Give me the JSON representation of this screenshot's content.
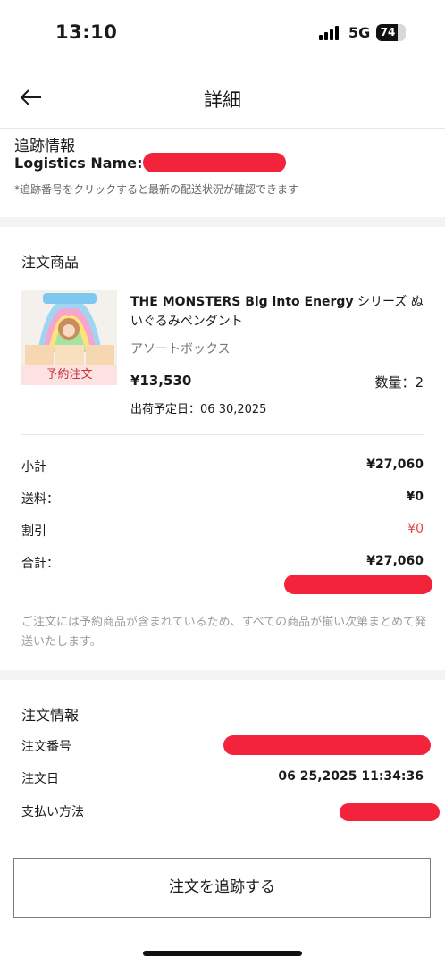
{
  "status_bar": {
    "time": "13:10",
    "network": "5G",
    "battery": "74",
    "battery_level": 0.74
  },
  "nav": {
    "title": "詳細"
  },
  "tracking": {
    "title": "追跡情報",
    "logistics_label": "Logistics Name:",
    "note": "*追跡番号をクリックすると最新の配送状況が確認できます"
  },
  "order_items": {
    "title": "注文商品",
    "product": {
      "name_en": "THE MONSTERS Big into Energy",
      "name_jp": " シリーズ ぬいぐるみペンダント",
      "variant": "アソートボックス",
      "price": "¥13,530",
      "quantity": "数量：2",
      "ship_date_label": "出荷予定日：",
      "ship_date": "06 30,2025",
      "tag": "予約注文"
    },
    "summary": [
      {
        "label": "小計",
        "value": "¥27,060"
      },
      {
        "label": "送料：",
        "value": "¥0"
      },
      {
        "label": "割引",
        "value": "¥0"
      },
      {
        "label": "合計：",
        "value": "¥27,060"
      }
    ],
    "notice": "ご注文には予約商品が含まれているため、すべての商品が揃い次第まとめて発送いたします。"
  },
  "order_info": {
    "title": "注文情報",
    "rows": [
      {
        "label": "注文番号",
        "value": ""
      },
      {
        "label": "注文日",
        "value": "06 25,2025 11:34:36"
      },
      {
        "label": "支払い方法",
        "value": ""
      }
    ]
  },
  "actions": {
    "track_order": "注文を追跡する"
  },
  "colors": {
    "redaction": "#f2233b",
    "discount_red": "#e0444d",
    "tag_bg": "#fde2e2",
    "tag_text": "#c8323c"
  }
}
